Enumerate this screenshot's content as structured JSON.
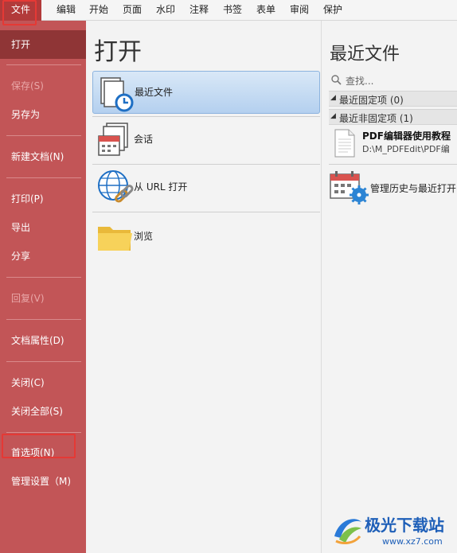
{
  "menubar": {
    "tabs": [
      "文件",
      "编辑",
      "开始",
      "页面",
      "水印",
      "注释",
      "书签",
      "表单",
      "审阅",
      "保护"
    ]
  },
  "sidebar": {
    "open": "打开",
    "save": "保存(S)",
    "save_as": "另存为",
    "new_doc": "新建文档(N)",
    "print": "打印(P)",
    "export": "导出",
    "share": "分享",
    "revert": "回复(V)",
    "doc_props": "文档属性(D)",
    "close": "关闭(C)",
    "close_all": "关闭全部(S)",
    "preferences": "首选项(N)",
    "manage_settings": "管理设置（M)"
  },
  "middle": {
    "heading": "打开",
    "options": {
      "recent": "最近文件",
      "session": "会话",
      "url": "从 URL 打开",
      "browse": "浏览"
    }
  },
  "right": {
    "heading": "最近文件",
    "search_placeholder": "查找...",
    "pinned_group": "最近固定项 (0)",
    "unpinned_group": "最近非固定项 (1)",
    "recent_file_name": "PDF编辑器使用教程",
    "recent_file_path": "D:\\M_PDFEdit\\PDF编",
    "manage_history": "管理历史与最近打开"
  },
  "watermark": {
    "brand": "极光下载站",
    "url": "www.xz7.com"
  },
  "colors": {
    "sidebar": "#c25557",
    "sidebar_active": "#8f3536",
    "highlight_box": "#e53935",
    "selected_option": "#b4d0ef"
  }
}
